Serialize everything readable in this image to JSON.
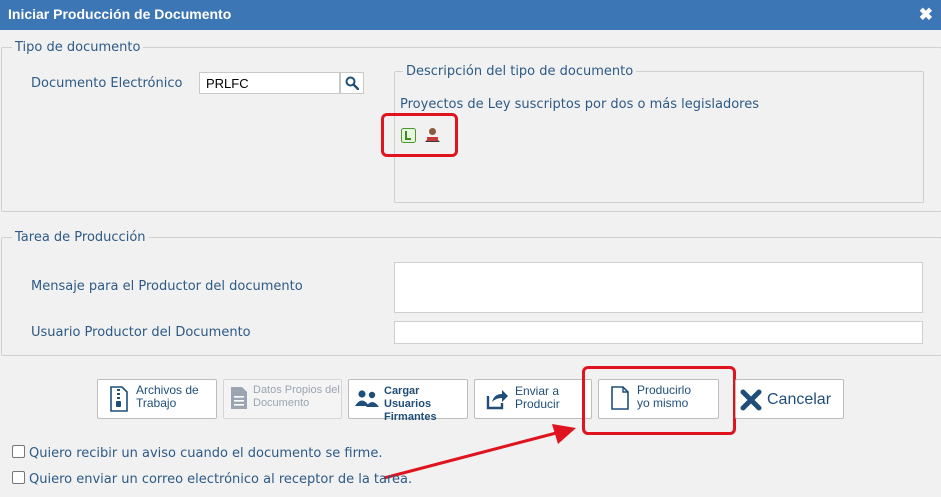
{
  "window": {
    "title": "Iniciar Producción de Documento",
    "close_glyph": "✖"
  },
  "tipo": {
    "legend": "Tipo de documento",
    "label": "Documento Electrónico",
    "input_value": "PRLFC",
    "search_icon": "search-icon",
    "descripcion": {
      "legend": "Descripción del tipo de documento",
      "text": "Proyectos de Ley suscriptos por dos o más legisladores",
      "icons": [
        "libre-icon",
        "signers-icon"
      ]
    }
  },
  "tarea": {
    "legend": "Tarea de Producción",
    "mensaje_label": "Mensaje para el Productor del documento",
    "usuario_label": "Usuario Productor del Documento"
  },
  "buttons": {
    "archivos": {
      "line1": "Archivos de",
      "line2": "Trabajo"
    },
    "datos": {
      "line1": "Datos Propios del",
      "line2": "Documento"
    },
    "cargar": {
      "line1": "Cargar Usuarios",
      "line2": "Firmantes"
    },
    "enviar": {
      "line1": "Enviar a",
      "line2": "Producir"
    },
    "producirlo": {
      "line1": "Producirlo",
      "line2": "yo mismo"
    },
    "cancelar": {
      "label": "Cancelar"
    }
  },
  "checkboxes": [
    {
      "label": "Quiero recibir un aviso cuando el documento se firme.",
      "checked": false
    },
    {
      "label": "Quiero enviar un correo electrónico al receptor de la tarea.",
      "checked": false
    }
  ],
  "colors": {
    "titlebar": "#3d76b5",
    "accent_text": "#2d5a86",
    "highlight": "#e0141e"
  }
}
